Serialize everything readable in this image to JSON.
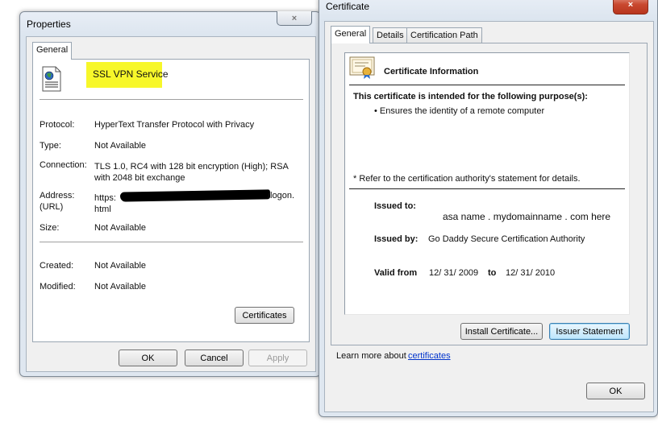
{
  "properties": {
    "title": "Properties",
    "close_glyph": "×",
    "tab_general": "General",
    "name": "SSL VPN Service",
    "protocol_label": "Protocol:",
    "protocol_value": "HyperText Transfer Protocol with Privacy",
    "type_label": "Type:",
    "type_value": "Not Available",
    "connection_label": "Connection:",
    "connection_value": "TLS 1.0, RC4 with 128 bit encryption (High); RSA with 2048 bit exchange",
    "address_label": "Address:",
    "url_label": "(URL)",
    "address_prefix": "https:",
    "address_suffix": "/logon.",
    "address_line2": "html",
    "size_label": "Size:",
    "size_value": "Not Available",
    "created_label": "Created:",
    "created_value": "Not Available",
    "modified_label": "Modified:",
    "modified_value": "Not Available",
    "certificates_button": "Certificates",
    "ok_button": "OK",
    "cancel_button": "Cancel",
    "apply_button": "Apply"
  },
  "certificate": {
    "title": "Certificate",
    "close_glyph": "×",
    "tabs": [
      "General",
      "Details",
      "Certification Path"
    ],
    "info_heading": "Certificate Information",
    "purpose_heading": "This certificate is intended for the following purpose(s):",
    "purpose_item": "• Ensures the identity of a remote computer",
    "refer_note": "* Refer to the certification authority's statement for details.",
    "issued_to_label": "Issued to:",
    "issued_to_value": "asa name . mydomainname . com here",
    "issued_by_label": "Issued by:",
    "issued_by_value": "Go Daddy Secure Certification Authority",
    "valid_from_label": "Valid from",
    "valid_from_value": "12/ 31/ 2009",
    "valid_to_label": "to",
    "valid_to_value": "12/ 31/ 2010",
    "install_button": "Install Certificate...",
    "issuer_button": "Issuer Statement",
    "learn_more_text": "Learn more about",
    "learn_more_link": "certificates",
    "ok_button": "OK"
  },
  "colors": {
    "highlight": "#f7f72a",
    "close_active": "#c9482f",
    "link": "#0033cc"
  }
}
